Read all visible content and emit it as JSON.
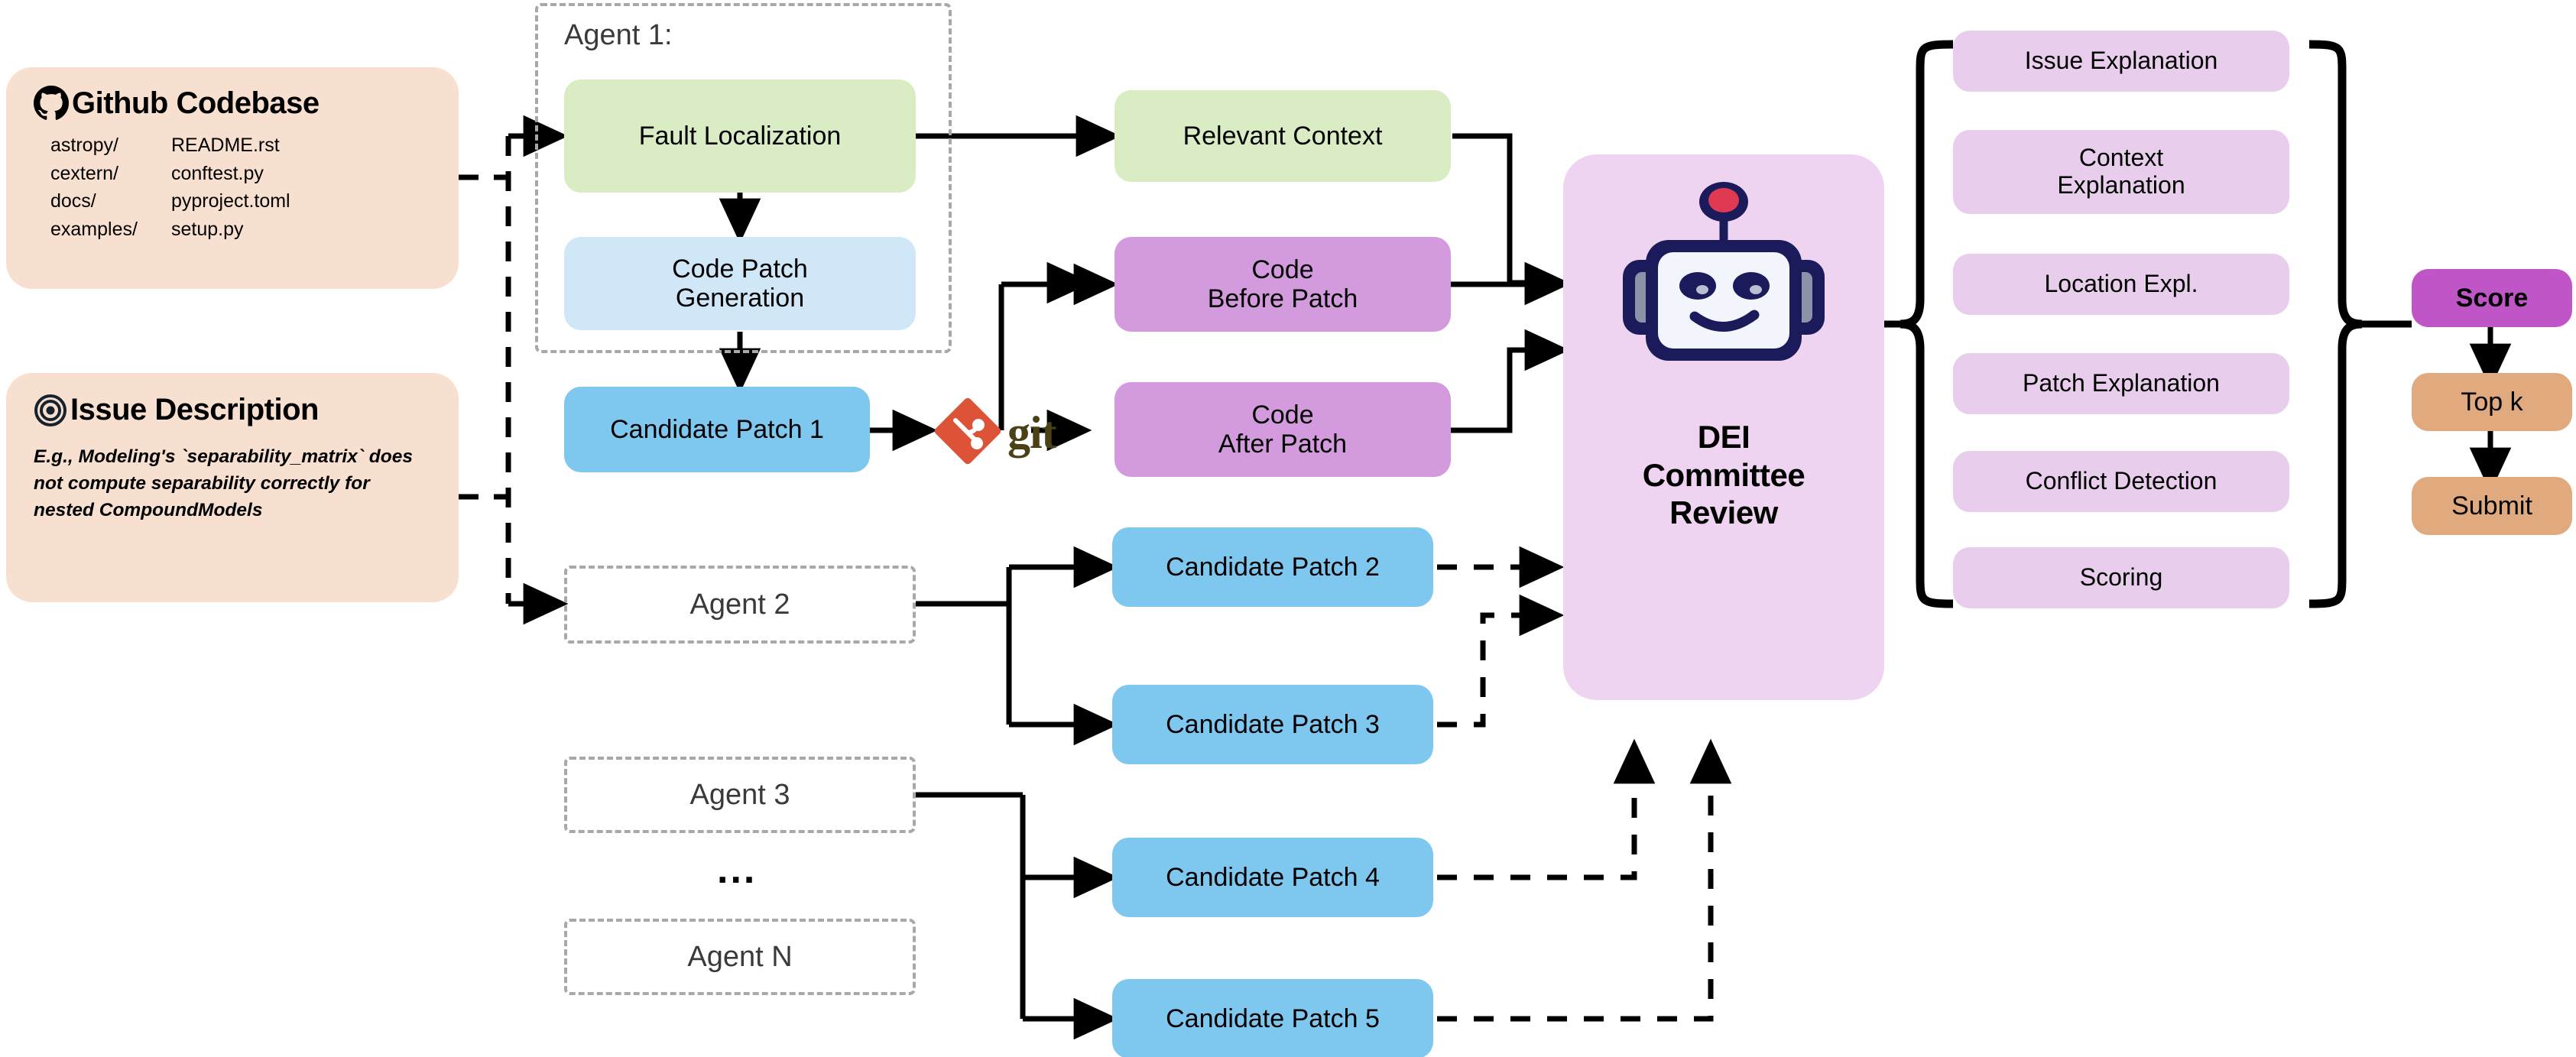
{
  "inputs": {
    "codebase": {
      "title": "Github Codebase",
      "icon": "github-icon",
      "col1": [
        "astropy/",
        "cextern/",
        "docs/",
        "examples/"
      ],
      "col2": [
        "README.rst",
        "conftest.py",
        "pyproject.toml",
        "setup.py"
      ]
    },
    "issue": {
      "title": "Issue Description",
      "icon": "target-icon",
      "body": "E.g., Modeling's `separability_matrix` does not compute separability correctly for nested CompoundModels"
    }
  },
  "agent1": {
    "label": "Agent 1:",
    "fault_localization": "Fault Localization",
    "code_patch_generation": "Code\nPatch\nGeneration",
    "code_patch_line1": "Code Patch",
    "code_patch_line2": "Generation",
    "candidate_patch": "Candidate Patch 1"
  },
  "agents": [
    {
      "label": "Agent 2"
    },
    {
      "label": "Agent 3"
    },
    {
      "label": "Agent N"
    }
  ],
  "ellipsis": "...",
  "git": {
    "label": "git",
    "icon": "git-logo-icon"
  },
  "artifacts": {
    "relevant_context": "Relevant Context",
    "code_before_line1": "Code",
    "code_before_line2": "Before Patch",
    "code_after_line1": "Code",
    "code_after_line2": "After Patch"
  },
  "candidate_patches": [
    "Candidate Patch 2",
    "Candidate Patch 3",
    "Candidate Patch 4",
    "Candidate Patch 5"
  ],
  "dei": {
    "title_line1": "DEI",
    "title_line2": "Committee",
    "title_line3": "Review",
    "icon": "robot-icon"
  },
  "review_items": [
    "Issue Explanation",
    "Context Explanation",
    "Location Expl.",
    "Patch Explanation",
    "Conflict Detection",
    "Scoring"
  ],
  "review_items_wrapped": {
    "context_line1": "Context",
    "context_line2": "Explanation"
  },
  "outputs": {
    "score": "Score",
    "topk": "Top k",
    "submit": "Submit"
  },
  "colors": {
    "panel_peach": "#f7e0cf",
    "green": "#d9ecc4",
    "light_blue": "#cfe7f7",
    "blue": "#7ec8f0",
    "purple_mid": "#d49ade",
    "purple_pale": "#eed4f0",
    "orchid": "#c055c8",
    "tan": "#e0a97e",
    "dashed_gray": "#a8a8a8",
    "git_red": "#dd5338",
    "git_text": "#4b4016",
    "robot_navy": "#1b1b5c",
    "robot_red": "#e03a52"
  }
}
